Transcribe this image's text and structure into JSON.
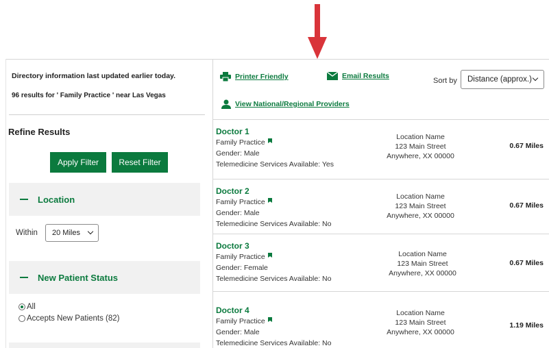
{
  "header": {
    "directory_info": "Directory information last updated earlier today.",
    "results_count": "96 results for ' Family Practice ' near Las Vegas"
  },
  "refine": {
    "title": "Refine Results",
    "apply_label": "Apply Filter",
    "reset_label": "Reset Filter"
  },
  "location_section": {
    "title": "Location",
    "within_label": "Within",
    "within_value": "20 Miles"
  },
  "new_patient_section": {
    "title": "New Patient Status",
    "options": [
      {
        "label": "All",
        "checked": true
      },
      {
        "label": "Accepts New Patients (82)",
        "checked": false
      }
    ]
  },
  "toolbar": {
    "printer_label": "Printer Friendly",
    "email_label": "Email Results",
    "national_label": "View National/Regional Providers",
    "sort_label": "Sort by",
    "sort_value": "Distance (approx.)"
  },
  "results": [
    {
      "name": "Doctor 1",
      "specialty": "Family Practice",
      "gender": "Gender: Male",
      "telemedicine": "Telemedicine Services Available: Yes",
      "location_name": "Location Name",
      "street": "123 Main Street",
      "city": "Anywhere, XX 00000",
      "distance": "0.67 Miles"
    },
    {
      "name": "Doctor 2",
      "specialty": "Family Practice",
      "gender": "Gender: Male",
      "telemedicine": "Telemedicine Services Available: No",
      "location_name": "Location Name",
      "street": "123 Main Street",
      "city": "Anywhere, XX 00000",
      "distance": "0.67 Miles"
    },
    {
      "name": "Doctor 3",
      "specialty": "Family Practice",
      "gender": "Gender: Female",
      "telemedicine": "Telemedicine Services Available: No",
      "location_name": "Location Name",
      "street": "123 Main Street",
      "city": "Anywhere, XX 00000",
      "distance": "0.67 Miles"
    },
    {
      "name": "Doctor 4",
      "specialty": "Family Practice",
      "gender": "Gender: Male",
      "telemedicine": "Telemedicine Services Available: No",
      "location_name": "Location Name",
      "street": "123 Main Street",
      "city": "Anywhere, XX 00000",
      "distance": "1.19 Miles"
    }
  ],
  "icons": {
    "arrow": "down-arrow-icon",
    "printer": "printer-icon",
    "email": "envelope-icon",
    "person": "person-icon",
    "flag": "flag-icon"
  },
  "colors": {
    "brand_green": "#0b7a3e",
    "arrow_red": "#d9343a",
    "section_bg": "#f1f1f1"
  }
}
